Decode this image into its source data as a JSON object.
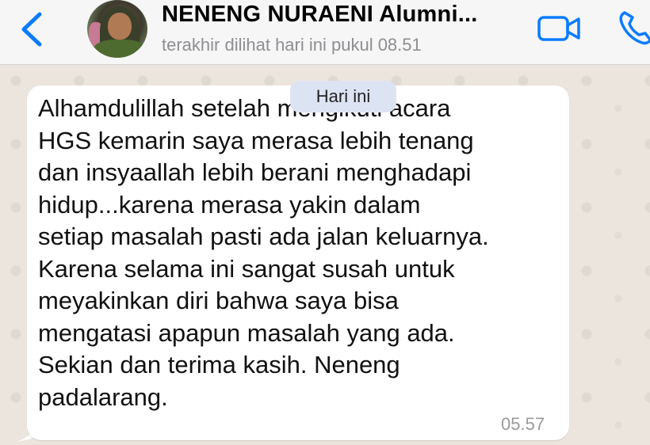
{
  "header": {
    "contact_name": "NENENG NURAENI Alumni...",
    "last_seen": "terakhir dilihat hari ini pukul 08.51",
    "back_icon": "chevron-left-icon",
    "video_icon": "video-camera-icon",
    "call_icon": "phone-icon",
    "accent_color": "#0a7cff"
  },
  "chat": {
    "date_label": "Hari ini",
    "message": {
      "text": "Alhamdulillah setelah mengikuti acara\nHGS kemarin saya merasa lebih tenang\ndan insyaallah lebih berani menghadapi\nhidup...karena merasa yakin dalam\nsetiap masalah pasti ada jalan keluarnya.\nKarena selama ini sangat susah untuk\nmeyakinkan diri bahwa saya bisa\nmengatasi apapun masalah yang ada.\nSekian dan terima kasih. Neneng\npadalarang.",
      "time": "05.57"
    }
  }
}
